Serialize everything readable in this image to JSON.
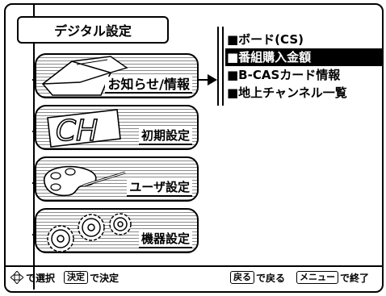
{
  "screen": {
    "title": "デジタル設定"
  },
  "tabs": [
    {
      "label": "お知らせ/情報",
      "active": true,
      "icon": "envelope-icon"
    },
    {
      "label": "初期設定",
      "active": false,
      "icon": "ch-icon"
    },
    {
      "label": "ユーザ設定",
      "active": false,
      "icon": "palette-icon"
    },
    {
      "label": "機器設定",
      "active": false,
      "icon": "gears-icon"
    }
  ],
  "submenu": {
    "items": [
      {
        "label": "■ボード(CS)",
        "selected": false
      },
      {
        "label": "■番組購入金額",
        "selected": true
      },
      {
        "label": "■B-CASカード情報",
        "selected": false
      },
      {
        "label": "■地上チャンネル一覧",
        "selected": false
      }
    ]
  },
  "footer": {
    "select_text": "で選択",
    "decide_key": "決定",
    "decide_text": "で決定",
    "back_key": "戻る",
    "back_text": "で戻る",
    "menu_key": "メニュー",
    "exit_text": "で終了"
  }
}
